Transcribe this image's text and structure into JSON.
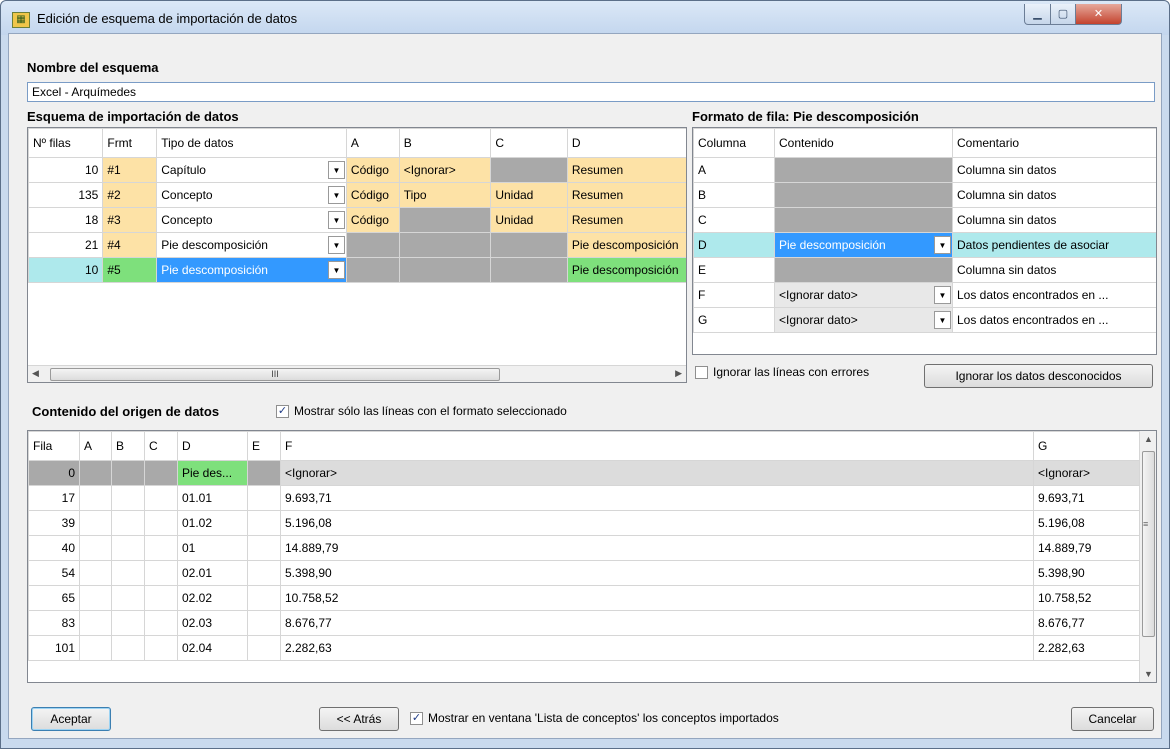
{
  "window": {
    "title": "Edición de esquema de importación de datos"
  },
  "schema_name": {
    "label": "Nombre del esquema",
    "value": "Excel - Arquímedes"
  },
  "schema_table": {
    "label": "Esquema de importación de datos",
    "columns": [
      "Nº filas",
      "Frmt",
      "Tipo de datos",
      "A",
      "B",
      "C",
      "D"
    ],
    "rows": [
      {
        "n": "10",
        "frmt": "#1",
        "tipo": "Capítulo",
        "a": "Código",
        "b": "<Ignorar>",
        "c": "",
        "d": "Resumen"
      },
      {
        "n": "135",
        "frmt": "#2",
        "tipo": "Concepto",
        "a": "Código",
        "b": "Tipo",
        "c": "Unidad",
        "d": "Resumen"
      },
      {
        "n": "18",
        "frmt": "#3",
        "tipo": "Concepto",
        "a": "Código",
        "b": "",
        "c": "Unidad",
        "d": "Resumen"
      },
      {
        "n": "21",
        "frmt": "#4",
        "tipo": "Pie descomposición",
        "a": "",
        "b": "",
        "c": "",
        "d": "Pie descomposición"
      },
      {
        "n": "10",
        "frmt": "#5",
        "tipo": "Pie descomposición",
        "a": "",
        "b": "",
        "c": "",
        "d": "Pie descomposición"
      }
    ],
    "scroll_glyph": "III"
  },
  "row_format": {
    "label": "Formato de fila: Pie descomposición",
    "columns": [
      "Columna",
      "Contenido",
      "Comentario"
    ],
    "rows": [
      {
        "col": "A",
        "contenido": "",
        "comentario": "Columna sin datos"
      },
      {
        "col": "B",
        "contenido": "",
        "comentario": "Columna sin datos"
      },
      {
        "col": "C",
        "contenido": "",
        "comentario": "Columna sin datos"
      },
      {
        "col": "D",
        "contenido": "Pie descomposición",
        "comentario": "Datos pendientes de asociar"
      },
      {
        "col": "E",
        "contenido": "",
        "comentario": "Columna sin datos"
      },
      {
        "col": "F",
        "contenido": "<Ignorar dato>",
        "comentario": "Los datos encontrados en ..."
      },
      {
        "col": "G",
        "contenido": "<Ignorar dato>",
        "comentario": "Los datos encontrados en ..."
      }
    ],
    "ignore_errors_label": "Ignorar las líneas con errores",
    "ignore_unknown_button": "Ignorar los datos desconocidos"
  },
  "source": {
    "label": "Contenido del origen de datos",
    "filter_label": "Mostrar sólo las líneas con el formato seleccionado",
    "filter_checked": true,
    "columns": [
      "Fila",
      "A",
      "B",
      "C",
      "D",
      "E",
      "F",
      "G"
    ],
    "header_row": {
      "fila": "0",
      "d": "Pie des...",
      "f": "<Ignorar>",
      "g": "<Ignorar>"
    },
    "rows": [
      {
        "fila": "17",
        "d": "01.01",
        "f": "9.693,71",
        "g": "9.693,71"
      },
      {
        "fila": "39",
        "d": "01.02",
        "f": "5.196,08",
        "g": "5.196,08"
      },
      {
        "fila": "40",
        "d": "01",
        "f": "14.889,79",
        "g": "14.889,79"
      },
      {
        "fila": "54",
        "d": "02.01",
        "f": "5.398,90",
        "g": "5.398,90"
      },
      {
        "fila": "65",
        "d": "02.02",
        "f": "10.758,52",
        "g": "10.758,52"
      },
      {
        "fila": "83",
        "d": "02.03",
        "f": "8.676,77",
        "g": "8.676,77"
      },
      {
        "fila": "101",
        "d": "02.04",
        "f": "2.282,63",
        "g": "2.282,63"
      }
    ]
  },
  "footer": {
    "accept": "Aceptar",
    "back": "<< Atrás",
    "show_concepts_label": "Mostrar en ventana 'Lista de conceptos' los conceptos importados",
    "show_concepts_checked": true,
    "cancel": "Cancelar"
  },
  "colors": {
    "orange": "#fde2a6",
    "grey": "#a9a9a9",
    "green": "#7ee07c",
    "cyan": "#aee9ec",
    "selection": "#3399ff"
  }
}
